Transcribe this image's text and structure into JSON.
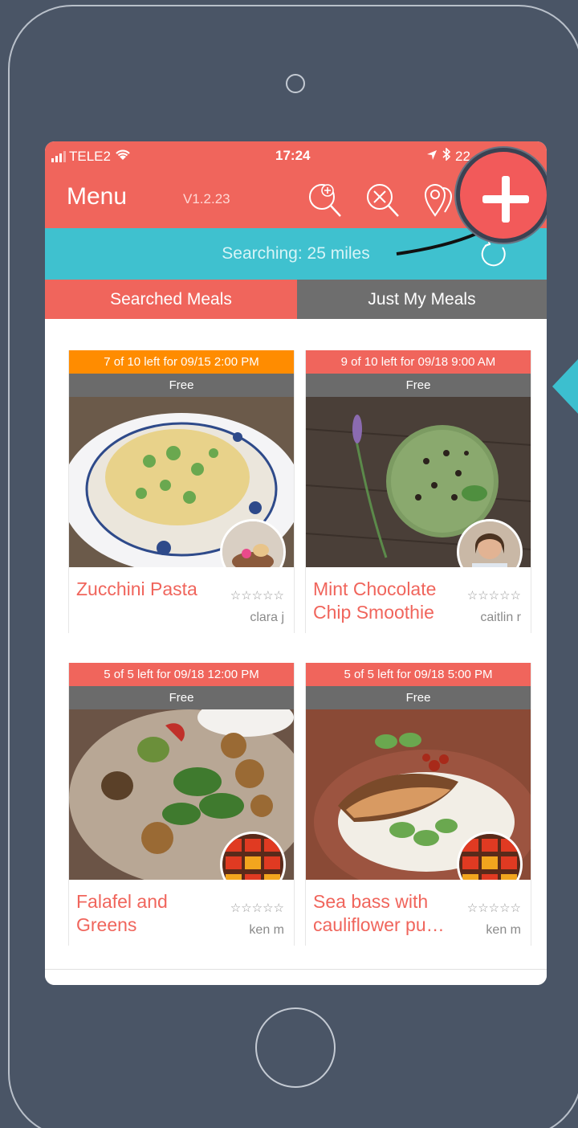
{
  "status_bar": {
    "carrier": "TELE2",
    "time": "17:24",
    "battery": "22"
  },
  "nav": {
    "menu_label": "Menu",
    "version": "V1.2.23"
  },
  "search": {
    "text": "Searching: 25 miles"
  },
  "tabs": [
    {
      "label": "Searched Meals"
    },
    {
      "label": "Just My Meals"
    }
  ],
  "meals": [
    {
      "slot": "7 of 10 left for 09/15 2:00 PM",
      "slot_color": "#ff8c00",
      "price": "Free",
      "title": "Zucchini Pasta",
      "stars": "☆☆☆☆☆",
      "user": "clara j",
      "photo": "pasta"
    },
    {
      "slot": "9 of 10 left for 09/18 9:00 AM",
      "slot_color": "#f0655c",
      "price": "Free",
      "title": "Mint Chocolate Chip Smoothie",
      "stars": "☆☆☆☆☆",
      "user": "caitlin r",
      "photo": "smoothie"
    },
    {
      "slot": "5 of 5 left for 09/18 12:00 PM",
      "slot_color": "#f0655c",
      "price": "Free",
      "title": "Falafel and Greens",
      "stars": "☆☆☆☆☆",
      "user": "ken m",
      "photo": "falafel"
    },
    {
      "slot": "5 of 5 left for 09/18 5:00 PM",
      "slot_color": "#f0655c",
      "price": "Free",
      "title": "Sea bass with cauliflower pu…",
      "stars": "☆☆☆☆☆",
      "user": "ken m",
      "photo": "seabass"
    }
  ],
  "colors": {
    "brand": "#f0655c",
    "search_bar": "#3fc1cf",
    "tab_inactive": "#6e6e6e",
    "background": "#4a5566"
  },
  "icons": [
    "add-meal-icon",
    "remove-search-icon",
    "location-pin-icon",
    "add-button-icon",
    "refresh-icon"
  ]
}
